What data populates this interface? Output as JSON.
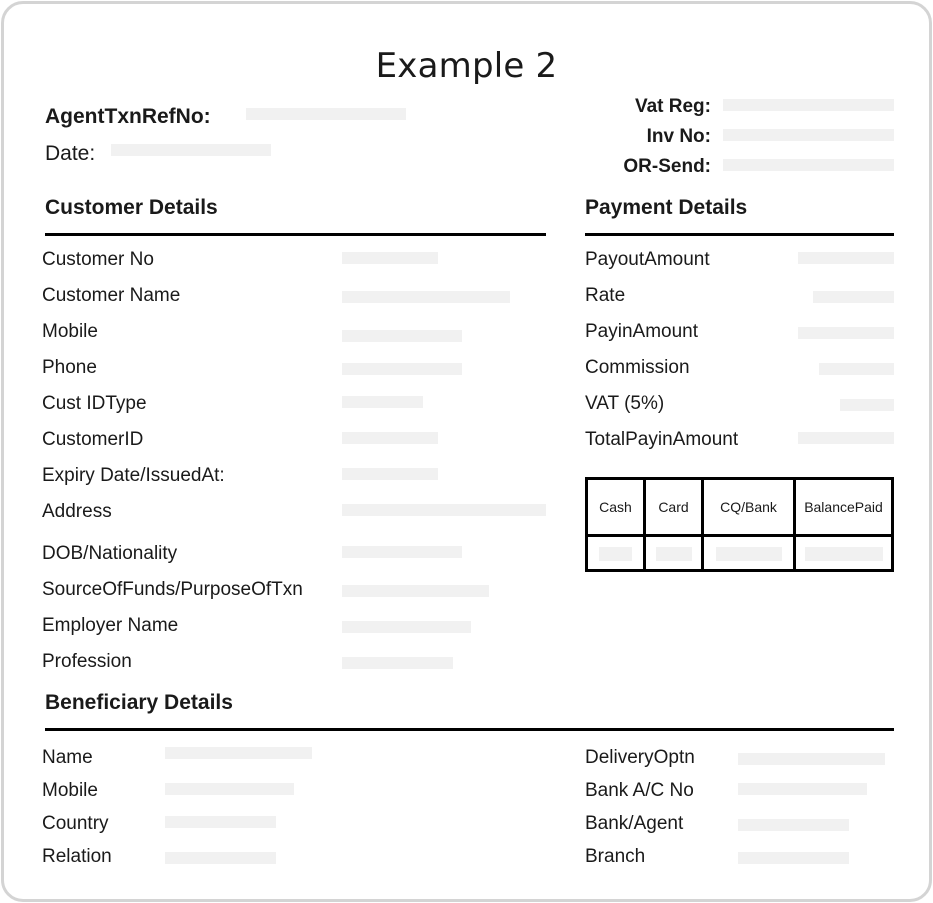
{
  "title": "Example 2",
  "header": {
    "agent_txn_ref_label": "AgentTxnRefNo:",
    "date_label": "Date:",
    "vat_reg_label": "Vat Reg:",
    "inv_no_label": "Inv No:",
    "or_send_label": "OR-Send:"
  },
  "customer": {
    "heading": "Customer Details",
    "fields": [
      {
        "label": "Customer No"
      },
      {
        "label": "Customer Name"
      },
      {
        "label": "Mobile"
      },
      {
        "label": "Phone"
      },
      {
        "label": "Cust IDType"
      },
      {
        "label": "CustomerID"
      },
      {
        "label": "Expiry Date/IssuedAt:"
      },
      {
        "label": "Address"
      },
      {
        "label": "DOB/Nationality"
      },
      {
        "label": "SourceOfFunds/PurposeOfTxn"
      },
      {
        "label": "Employer Name"
      },
      {
        "label": "Profession"
      }
    ]
  },
  "payment": {
    "heading": "Payment Details",
    "fields": [
      {
        "label": "PayoutAmount"
      },
      {
        "label": "Rate"
      },
      {
        "label": "PayinAmount"
      },
      {
        "label": "Commission"
      },
      {
        "label": "VAT (5%)"
      },
      {
        "label": "TotalPayinAmount"
      }
    ],
    "table": {
      "columns": [
        "Cash",
        "Card",
        "CQ/Bank",
        "BalancePaid"
      ]
    }
  },
  "beneficiary": {
    "heading": "Beneficiary Details",
    "left_fields": [
      {
        "label": "Name"
      },
      {
        "label": "Mobile"
      },
      {
        "label": "Country"
      },
      {
        "label": "Relation"
      }
    ],
    "right_fields": [
      {
        "label": "DeliveryOptn"
      },
      {
        "label": "Bank A/C No"
      },
      {
        "label": "Bank/Agent"
      },
      {
        "label": "Branch"
      }
    ]
  }
}
